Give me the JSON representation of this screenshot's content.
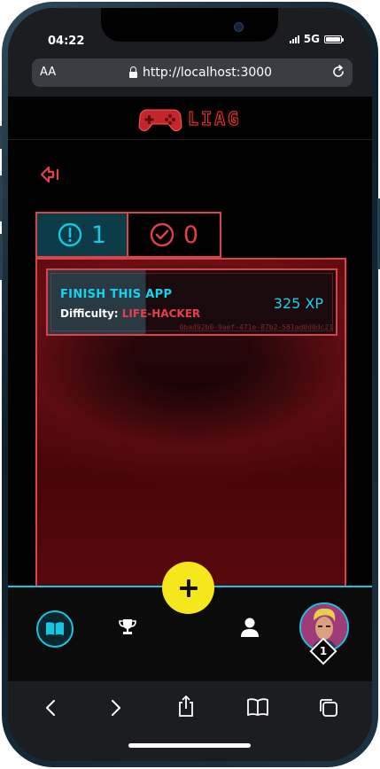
{
  "status_bar": {
    "time": "04:22",
    "network": "5G"
  },
  "browser": {
    "text_size_label": "AA",
    "url": "http://localhost:3000"
  },
  "app": {
    "logo_text": "LIAG"
  },
  "tabs": [
    {
      "id": "open",
      "count": "1",
      "icon": "exclamation-circle-icon",
      "active": true
    },
    {
      "id": "completed",
      "count": "0",
      "icon": "check-circle-icon",
      "active": false
    }
  ],
  "quests": [
    {
      "title": "FINISH THIS APP",
      "difficulty_label": "Difficulty:",
      "difficulty_value": "LIFE-HACKER",
      "xp": "325 XP",
      "id": "0bad92b0-9aef-471e-87b2-581ad0d0dc21"
    }
  ],
  "bottom_nav": {
    "items": [
      "book-icon",
      "trophy-icon",
      "add-icon",
      "user-icon",
      "avatar"
    ],
    "level": "1"
  },
  "colors": {
    "accent_cyan": "#16c7e0",
    "accent_red": "#d8444c",
    "add_yellow": "#f6e71c"
  }
}
